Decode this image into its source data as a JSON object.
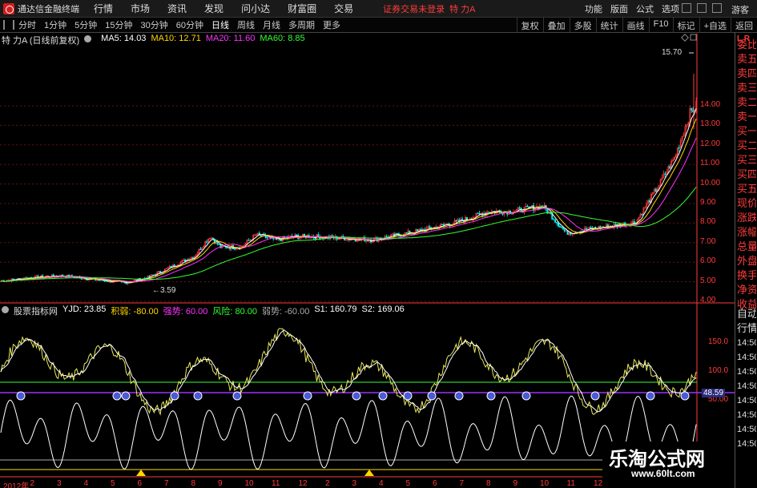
{
  "titlebar": {
    "app_title": "通达信金融终端",
    "menu": [
      "行情",
      "市场",
      "资讯",
      "发现",
      "问小达",
      "财富圈",
      "交易"
    ],
    "login_status": "证券交易未登录",
    "stock_name": "特 力A",
    "right_menu": [
      "功能",
      "版面",
      "公式",
      "选项"
    ],
    "guest": "游客"
  },
  "toolbar": {
    "periods": [
      "分时",
      "1分钟",
      "5分钟",
      "15分钟",
      "30分钟",
      "60分钟",
      "日线",
      "周线",
      "月线",
      "多周期",
      "更多"
    ],
    "active": "日线",
    "right_buttons": [
      "复权",
      "叠加",
      "多股",
      "统计",
      "画线",
      "F10",
      "标记",
      "+自选",
      "返回"
    ]
  },
  "main_chart": {
    "stock": "特 力A (日线前复权)",
    "ma": [
      {
        "label": "MA5: 14.03",
        "color": "#ffffff"
      },
      {
        "label": "MA10: 12.71",
        "color": "#ffd700"
      },
      {
        "label": "MA20: 11.60",
        "color": "#ff33ff"
      },
      {
        "label": "MA60: 8.85",
        "color": "#33ff33"
      }
    ],
    "y_axis": [
      "14.00",
      "13.00",
      "12.00",
      "11.00",
      "10.00",
      "9.00",
      "8.00",
      "7.00",
      "6.00",
      "5.00",
      "4.00"
    ],
    "high_label": "15.70",
    "low_label": "3.59"
  },
  "indicator": {
    "name": "股票指标网",
    "values": [
      {
        "label": "YJD: 23.85",
        "color": "#ffffff"
      },
      {
        "label": "积弱: -80.00",
        "color": "#ffd700"
      },
      {
        "label": "强势: 60.00",
        "color": "#ff33ff"
      },
      {
        "label": "风险: 80.00",
        "color": "#33ff33"
      },
      {
        "label": "弱势: -60.00",
        "color": "#aaaaaa"
      },
      {
        "label": "S1: 160.79",
        "color": "#ffffff"
      },
      {
        "label": "S2: 169.06",
        "color": "#ffffff"
      }
    ],
    "y_axis": [
      "150.0",
      "100.0",
      "50.00"
    ],
    "marker_value": "48.59"
  },
  "x_axis": [
    "2012年",
    "2",
    "3",
    "4",
    "5",
    "6",
    "7",
    "8",
    "9",
    "10",
    "11",
    "12",
    "2",
    "3",
    "4",
    "5",
    "6",
    "7",
    "8",
    "9",
    "10",
    "11",
    "12"
  ],
  "right_panel": {
    "top": "L R",
    "items": [
      "委比",
      "卖五",
      "卖四",
      "卖三",
      "卖二",
      "卖一",
      "买一",
      "买二",
      "买三",
      "买四",
      "买五",
      "现价",
      "涨跌",
      "涨幅",
      "总量",
      "外盘",
      "换手",
      "净资",
      "收益"
    ],
    "items2": [
      "自动",
      "行情",
      "14:50",
      "14:50",
      "14:50",
      "14:50",
      "14:50",
      "14:50",
      "14:50",
      "14:50"
    ]
  },
  "watermark": {
    "title": "乐淘公式网",
    "url": "www.60lt.com"
  },
  "colors": {
    "up": "#ff3b3b",
    "down": "#00ffff",
    "ma5": "#ffffff",
    "ma10": "#ffd700",
    "ma20": "#ff33ff",
    "ma60": "#33ff33"
  }
}
